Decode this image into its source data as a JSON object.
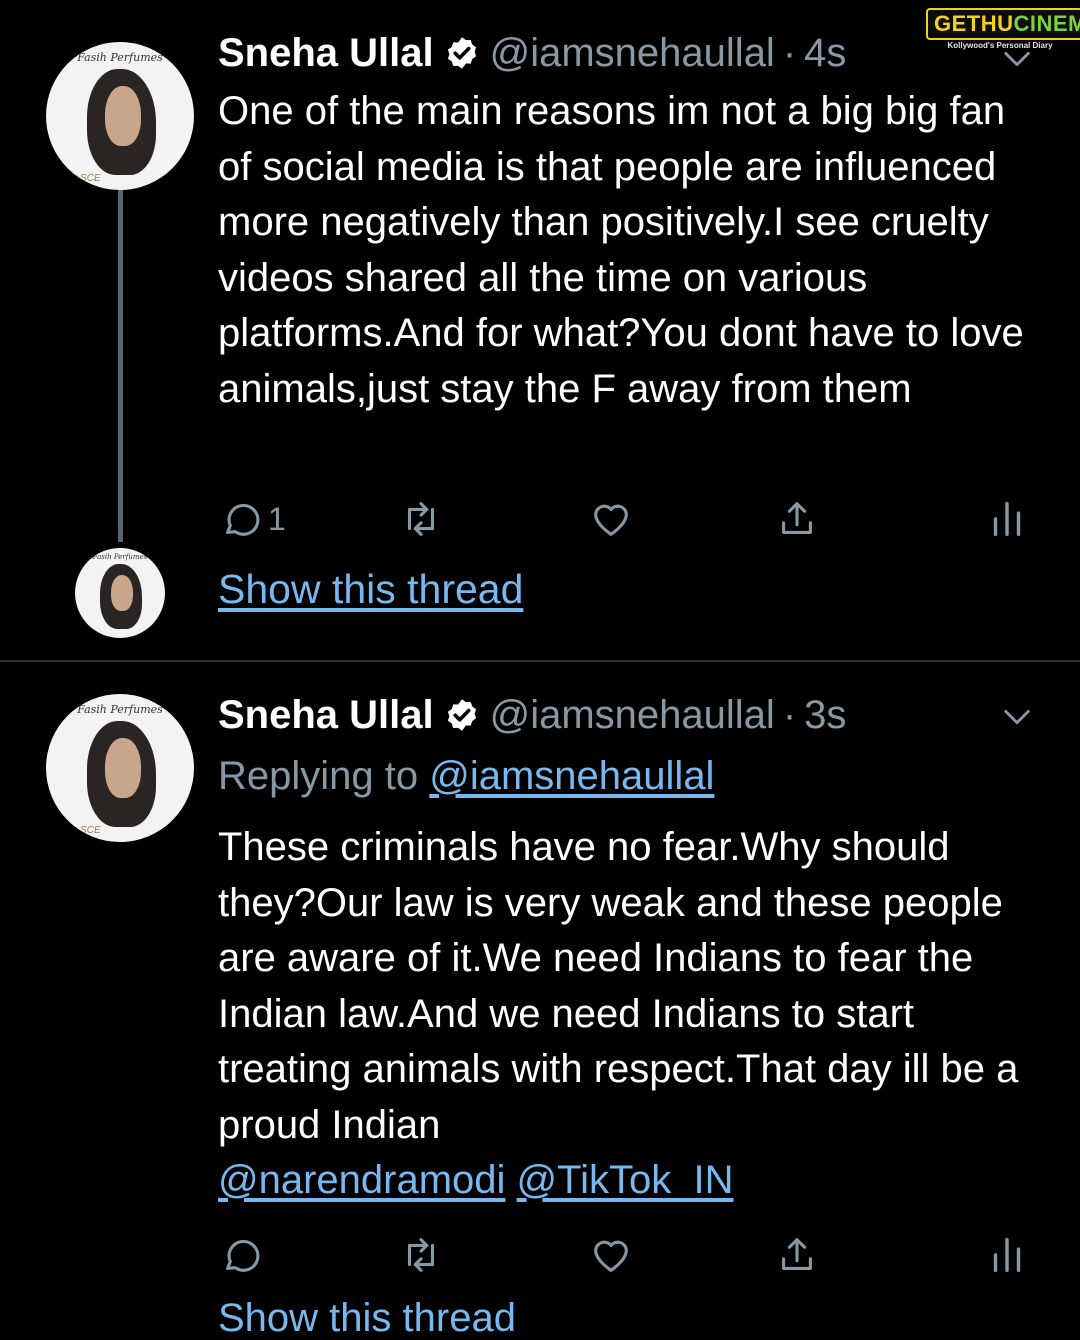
{
  "watermark": {
    "brand_a": "GETHU",
    "brand_b": "CINEMA",
    "tagline": "Kollywood's Personal Diary"
  },
  "avatar": {
    "brand": "Fasih Perfumes",
    "seal": "your SCE"
  },
  "tweets": [
    {
      "name": "Sneha Ullal",
      "handle": "@iamsnehaullal",
      "dot": "·",
      "time": "4s",
      "text": "One of the main reasons im not a big big fan of social media is that people are influenced more negatively than positively.I see cruelty videos shared all the time on various platforms.And for what?You dont have to love animals,just stay the F away from them",
      "reply_count": "1"
    },
    {
      "name": "Sneha Ullal",
      "handle": "@iamsnehaullal",
      "dot": "·",
      "time": "3s",
      "replying_prefix": "Replying to",
      "replying_to": "@iamsnehaullal",
      "text": "These criminals have no fear.Why should they?Our law is very weak and these people are aware of it.We need Indians to fear the Indian law.And we need Indians to start treating animals with respect.That day ill be a proud Indian",
      "mention_1": "@narendramodi",
      "mention_2": "@TikTok_IN",
      "reply_count": ""
    }
  ],
  "show_thread_label": "Show this thread",
  "partial_text": "Show this thread",
  "colors": {
    "background": "#000000",
    "secondary": "#8899a6",
    "link": "#79b8ee",
    "divider": "#2f3336"
  },
  "icons": [
    "reply-icon",
    "retweet-icon",
    "like-icon",
    "share-icon",
    "analytics-icon",
    "verified-icon",
    "chevron-down-icon"
  ]
}
